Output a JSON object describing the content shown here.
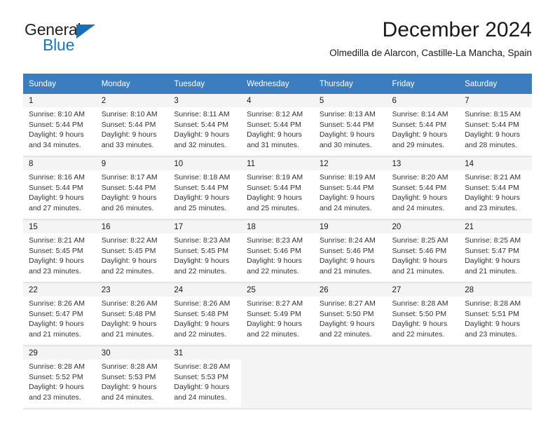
{
  "brand": {
    "line1": "General",
    "line2": "Blue",
    "triangle_color": "#136fba",
    "blue_color": "#1577c4"
  },
  "header": {
    "title": "December 2024",
    "subtitle": "Olmedilla de Alarcon, Castille-La Mancha, Spain"
  },
  "calendar": {
    "header_bg": "#3b7dbf",
    "shaded_row_bg": "#f4f4f4",
    "weekdays": [
      "Sunday",
      "Monday",
      "Tuesday",
      "Wednesday",
      "Thursday",
      "Friday",
      "Saturday"
    ],
    "weeks": [
      [
        {
          "day": "1",
          "sunrise": "Sunrise: 8:10 AM",
          "sunset": "Sunset: 5:44 PM",
          "daylight_line1": "Daylight: 9 hours",
          "daylight_line2": "and 34 minutes."
        },
        {
          "day": "2",
          "sunrise": "Sunrise: 8:10 AM",
          "sunset": "Sunset: 5:44 PM",
          "daylight_line1": "Daylight: 9 hours",
          "daylight_line2": "and 33 minutes."
        },
        {
          "day": "3",
          "sunrise": "Sunrise: 8:11 AM",
          "sunset": "Sunset: 5:44 PM",
          "daylight_line1": "Daylight: 9 hours",
          "daylight_line2": "and 32 minutes."
        },
        {
          "day": "4",
          "sunrise": "Sunrise: 8:12 AM",
          "sunset": "Sunset: 5:44 PM",
          "daylight_line1": "Daylight: 9 hours",
          "daylight_line2": "and 31 minutes."
        },
        {
          "day": "5",
          "sunrise": "Sunrise: 8:13 AM",
          "sunset": "Sunset: 5:44 PM",
          "daylight_line1": "Daylight: 9 hours",
          "daylight_line2": "and 30 minutes."
        },
        {
          "day": "6",
          "sunrise": "Sunrise: 8:14 AM",
          "sunset": "Sunset: 5:44 PM",
          "daylight_line1": "Daylight: 9 hours",
          "daylight_line2": "and 29 minutes."
        },
        {
          "day": "7",
          "sunrise": "Sunrise: 8:15 AM",
          "sunset": "Sunset: 5:44 PM",
          "daylight_line1": "Daylight: 9 hours",
          "daylight_line2": "and 28 minutes."
        }
      ],
      [
        {
          "day": "8",
          "sunrise": "Sunrise: 8:16 AM",
          "sunset": "Sunset: 5:44 PM",
          "daylight_line1": "Daylight: 9 hours",
          "daylight_line2": "and 27 minutes."
        },
        {
          "day": "9",
          "sunrise": "Sunrise: 8:17 AM",
          "sunset": "Sunset: 5:44 PM",
          "daylight_line1": "Daylight: 9 hours",
          "daylight_line2": "and 26 minutes."
        },
        {
          "day": "10",
          "sunrise": "Sunrise: 8:18 AM",
          "sunset": "Sunset: 5:44 PM",
          "daylight_line1": "Daylight: 9 hours",
          "daylight_line2": "and 25 minutes."
        },
        {
          "day": "11",
          "sunrise": "Sunrise: 8:19 AM",
          "sunset": "Sunset: 5:44 PM",
          "daylight_line1": "Daylight: 9 hours",
          "daylight_line2": "and 25 minutes."
        },
        {
          "day": "12",
          "sunrise": "Sunrise: 8:19 AM",
          "sunset": "Sunset: 5:44 PM",
          "daylight_line1": "Daylight: 9 hours",
          "daylight_line2": "and 24 minutes."
        },
        {
          "day": "13",
          "sunrise": "Sunrise: 8:20 AM",
          "sunset": "Sunset: 5:44 PM",
          "daylight_line1": "Daylight: 9 hours",
          "daylight_line2": "and 24 minutes."
        },
        {
          "day": "14",
          "sunrise": "Sunrise: 8:21 AM",
          "sunset": "Sunset: 5:44 PM",
          "daylight_line1": "Daylight: 9 hours",
          "daylight_line2": "and 23 minutes."
        }
      ],
      [
        {
          "day": "15",
          "sunrise": "Sunrise: 8:21 AM",
          "sunset": "Sunset: 5:45 PM",
          "daylight_line1": "Daylight: 9 hours",
          "daylight_line2": "and 23 minutes."
        },
        {
          "day": "16",
          "sunrise": "Sunrise: 8:22 AM",
          "sunset": "Sunset: 5:45 PM",
          "daylight_line1": "Daylight: 9 hours",
          "daylight_line2": "and 22 minutes."
        },
        {
          "day": "17",
          "sunrise": "Sunrise: 8:23 AM",
          "sunset": "Sunset: 5:45 PM",
          "daylight_line1": "Daylight: 9 hours",
          "daylight_line2": "and 22 minutes."
        },
        {
          "day": "18",
          "sunrise": "Sunrise: 8:23 AM",
          "sunset": "Sunset: 5:46 PM",
          "daylight_line1": "Daylight: 9 hours",
          "daylight_line2": "and 22 minutes."
        },
        {
          "day": "19",
          "sunrise": "Sunrise: 8:24 AM",
          "sunset": "Sunset: 5:46 PM",
          "daylight_line1": "Daylight: 9 hours",
          "daylight_line2": "and 21 minutes."
        },
        {
          "day": "20",
          "sunrise": "Sunrise: 8:25 AM",
          "sunset": "Sunset: 5:46 PM",
          "daylight_line1": "Daylight: 9 hours",
          "daylight_line2": "and 21 minutes."
        },
        {
          "day": "21",
          "sunrise": "Sunrise: 8:25 AM",
          "sunset": "Sunset: 5:47 PM",
          "daylight_line1": "Daylight: 9 hours",
          "daylight_line2": "and 21 minutes."
        }
      ],
      [
        {
          "day": "22",
          "sunrise": "Sunrise: 8:26 AM",
          "sunset": "Sunset: 5:47 PM",
          "daylight_line1": "Daylight: 9 hours",
          "daylight_line2": "and 21 minutes."
        },
        {
          "day": "23",
          "sunrise": "Sunrise: 8:26 AM",
          "sunset": "Sunset: 5:48 PM",
          "daylight_line1": "Daylight: 9 hours",
          "daylight_line2": "and 21 minutes."
        },
        {
          "day": "24",
          "sunrise": "Sunrise: 8:26 AM",
          "sunset": "Sunset: 5:48 PM",
          "daylight_line1": "Daylight: 9 hours",
          "daylight_line2": "and 22 minutes."
        },
        {
          "day": "25",
          "sunrise": "Sunrise: 8:27 AM",
          "sunset": "Sunset: 5:49 PM",
          "daylight_line1": "Daylight: 9 hours",
          "daylight_line2": "and 22 minutes."
        },
        {
          "day": "26",
          "sunrise": "Sunrise: 8:27 AM",
          "sunset": "Sunset: 5:50 PM",
          "daylight_line1": "Daylight: 9 hours",
          "daylight_line2": "and 22 minutes."
        },
        {
          "day": "27",
          "sunrise": "Sunrise: 8:28 AM",
          "sunset": "Sunset: 5:50 PM",
          "daylight_line1": "Daylight: 9 hours",
          "daylight_line2": "and 22 minutes."
        },
        {
          "day": "28",
          "sunrise": "Sunrise: 8:28 AM",
          "sunset": "Sunset: 5:51 PM",
          "daylight_line1": "Daylight: 9 hours",
          "daylight_line2": "and 23 minutes."
        }
      ],
      [
        {
          "day": "29",
          "sunrise": "Sunrise: 8:28 AM",
          "sunset": "Sunset: 5:52 PM",
          "daylight_line1": "Daylight: 9 hours",
          "daylight_line2": "and 23 minutes."
        },
        {
          "day": "30",
          "sunrise": "Sunrise: 8:28 AM",
          "sunset": "Sunset: 5:53 PM",
          "daylight_line1": "Daylight: 9 hours",
          "daylight_line2": "and 24 minutes."
        },
        {
          "day": "31",
          "sunrise": "Sunrise: 8:28 AM",
          "sunset": "Sunset: 5:53 PM",
          "daylight_line1": "Daylight: 9 hours",
          "daylight_line2": "and 24 minutes."
        },
        {
          "day": "",
          "sunrise": "",
          "sunset": "",
          "daylight_line1": "",
          "daylight_line2": ""
        },
        {
          "day": "",
          "sunrise": "",
          "sunset": "",
          "daylight_line1": "",
          "daylight_line2": ""
        },
        {
          "day": "",
          "sunrise": "",
          "sunset": "",
          "daylight_line1": "",
          "daylight_line2": ""
        },
        {
          "day": "",
          "sunrise": "",
          "sunset": "",
          "daylight_line1": "",
          "daylight_line2": ""
        }
      ]
    ]
  }
}
